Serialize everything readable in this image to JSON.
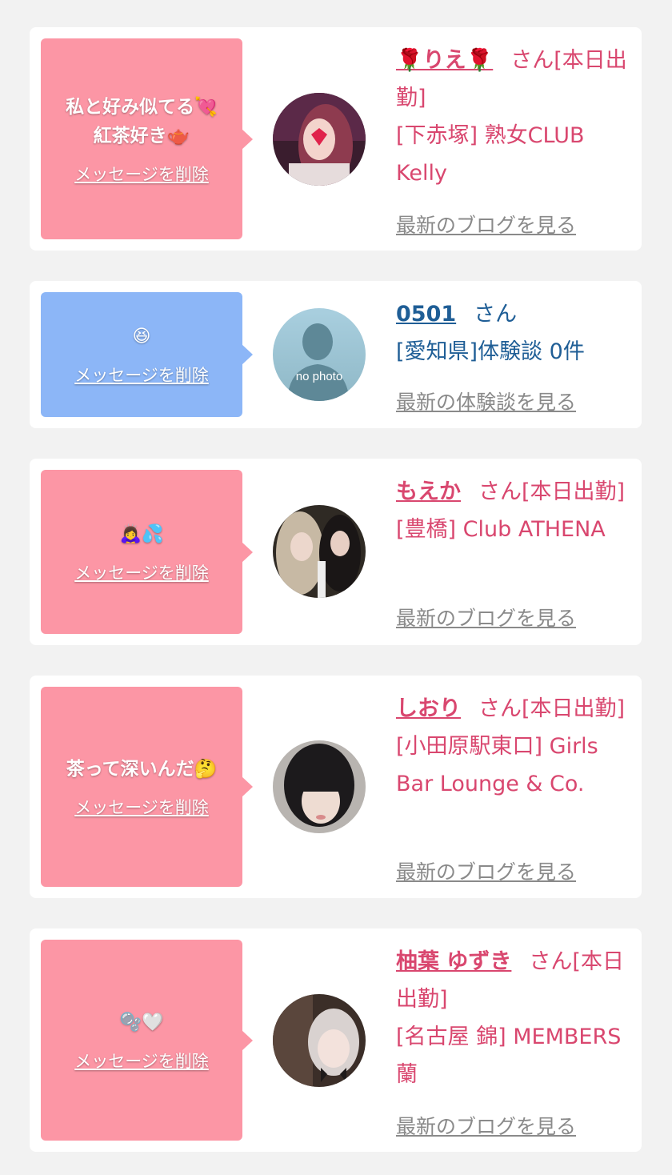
{
  "cards": [
    {
      "bubble_color": "#fc96a5",
      "message": "私と好み似てる💘\n紅茶好き🫖",
      "delete_label": "メッセージを削除",
      "name": "🌹りえ🌹",
      "suffix": "さん[本日出勤]",
      "shop": "[下赤塚] 熟女CLUB Kelly",
      "link": "最新のブログを見る"
    },
    {
      "bubble_color": "#8cb6f7",
      "message": "😆",
      "delete_label": "メッセージを削除",
      "name": "0501",
      "suffix": "さん",
      "shop": "[愛知県]体験談 0件",
      "link": "最新の体験談を見る",
      "avatar_text": "no photo"
    },
    {
      "bubble_color": "#fc96a5",
      "message": "🙇‍♀️💦",
      "delete_label": "メッセージを削除",
      "name": "もえか",
      "suffix": "さん[本日出勤]",
      "shop": "[豊橋] Club ATHENA",
      "link": "最新のブログを見る"
    },
    {
      "bubble_color": "#fc96a5",
      "message": "茶って深いんだ🤔",
      "delete_label": "メッセージを削除",
      "name": "しおり",
      "suffix": "さん[本日出勤]",
      "shop": "[小田原駅東口] Girls Bar Lounge & Co.",
      "link": "最新のブログを見る"
    },
    {
      "bubble_color": "#fc96a5",
      "message": "🫧🤍",
      "delete_label": "メッセージを削除",
      "name": "柚葉 ゆずき",
      "suffix": "さん[本日出勤]",
      "shop": "[名古屋 錦] MEMBERS 蘭",
      "link": "最新のブログを見る"
    }
  ],
  "colors": {
    "name_pink": "#d9476f",
    "name_blue": "#1f5e96",
    "link_gray": "#8a8a8a"
  }
}
